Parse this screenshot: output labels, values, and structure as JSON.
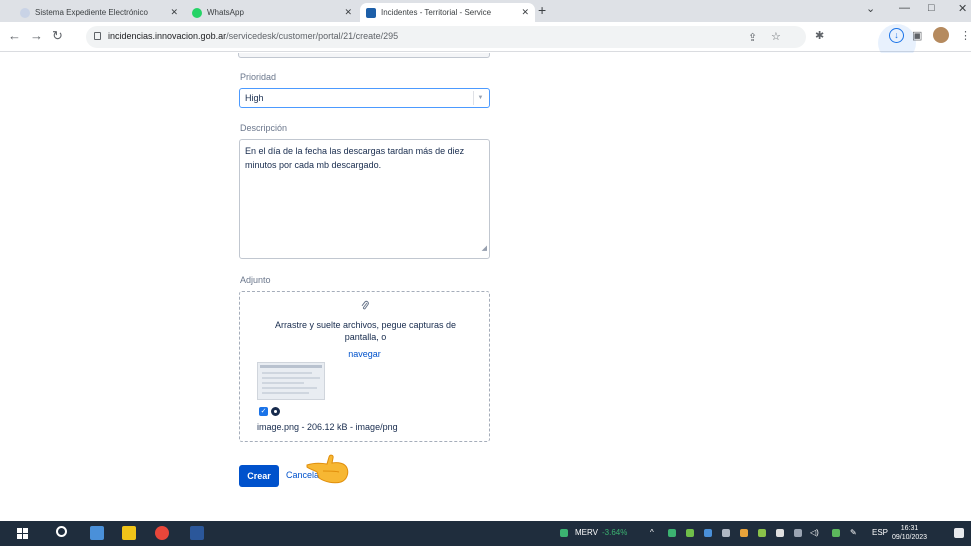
{
  "browser": {
    "tabs": [
      {
        "title": "Sistema Expediente Electrónico",
        "active": false
      },
      {
        "title": "WhatsApp",
        "active": false
      },
      {
        "title": "Incidentes - Territorial - Service",
        "active": true
      }
    ],
    "new_tab_symbol": "+",
    "url_host": "incidencias.innovacion.gob.ar",
    "url_path": "/servicedesk/customer/portal/21/create/295"
  },
  "form": {
    "priority_label": "Prioridad",
    "priority_value": "High",
    "description_label": "Descripción",
    "description_value": "En el día de la fecha las descargas tardan más de diez minutos por cada mb descargado.",
    "attachment_label": "Adjunto",
    "drop_text": "Arrastre y suelte archivos, pegue capturas de pantalla, o",
    "browse_link": "navegar",
    "file_meta": "image.png - 206.12 kB - image/png",
    "create_button": "Crear",
    "cancel_link": "Cancela"
  },
  "taskbar": {
    "ticker_name": "MERV",
    "ticker_change": "-3.64%",
    "language": "ESP",
    "time": "16:31",
    "date": "09/10/2023"
  },
  "colors": {
    "primary": "#0052cc",
    "focus_border": "#4c9aff",
    "taskbar": "#1f2d3d",
    "ticker_negative": "#3cb371"
  },
  "icons": [
    "back-icon",
    "forward-icon",
    "reload-icon",
    "lock-icon",
    "share-icon",
    "star-icon",
    "extensions-icon",
    "download-icon",
    "sidepanel-icon",
    "profile-avatar",
    "menu-icon",
    "paperclip-icon",
    "checkbox-icon",
    "remove-icon",
    "pointing-hand-icon",
    "windows-start-icon",
    "taskbar-search-icon",
    "notification-icon"
  ]
}
